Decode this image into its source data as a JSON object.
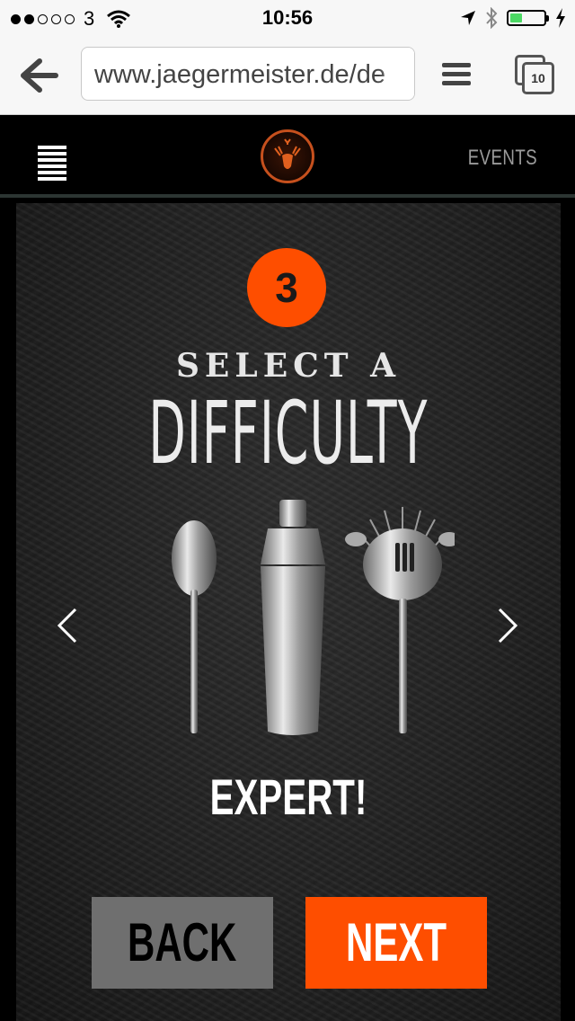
{
  "status_bar": {
    "carrier": "3",
    "time": "10:56",
    "signal_dots_filled": 2,
    "signal_dots_total": 5,
    "battery_level": 0.35
  },
  "browser": {
    "url": "www.jaegermeister.de/de",
    "tab_count": "10",
    "icons": [
      "back-arrow-icon",
      "menu-icon",
      "tabs-icon"
    ]
  },
  "header": {
    "events_label": "EVENTS",
    "logo": "jaegermeister-stag-logo"
  },
  "wizard": {
    "step_number": "3",
    "title_line1": "SELECT A",
    "title_line2": "DIFFICULTY",
    "level_label": "EXPERT!",
    "back_label": "BACK",
    "next_label": "NEXT"
  },
  "colors": {
    "accent": "#fe4e00",
    "back_button": "#6f6f6f",
    "battery_fill": "#4cd964"
  }
}
